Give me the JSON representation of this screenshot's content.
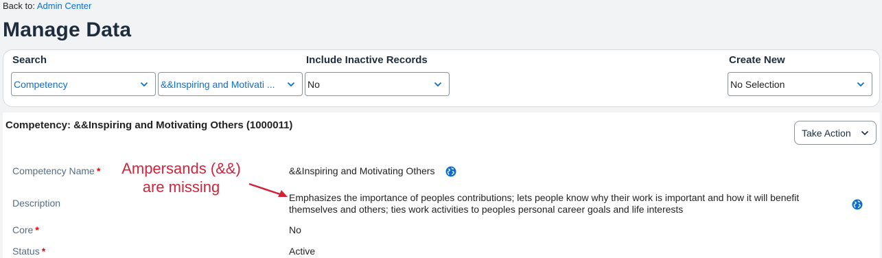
{
  "back": {
    "prefix": "Back to:",
    "link": "Admin Center"
  },
  "page_title": "Manage Data",
  "search": {
    "label": "Search",
    "type_value": "Competency",
    "record_value": "&&Inspiring and Motivati ...",
    "inactive_label": "Include Inactive Records",
    "inactive_value": "No",
    "create_label": "Create New",
    "create_value": "No Selection"
  },
  "record": {
    "title": "Competency: &&Inspiring and Motivating Others (1000011)",
    "take_action": "Take Action",
    "fields": {
      "name_label": "Competency Name",
      "name_value": "&&Inspiring and Motivating Others",
      "description_label": "Description",
      "description_value": "Emphasizes the importance of peoples contributions; lets people know why their work is important and how it will benefit themselves and others; ties work activities to peoples personal career goals and life interests",
      "core_label": "Core",
      "core_value": "No",
      "status_label": "Status",
      "status_value": "Active",
      "required_mark": "*"
    }
  },
  "annotation": {
    "line1": "Ampersands (&&)",
    "line2": "are missing"
  },
  "colors": {
    "link": "#0a6ed1",
    "required": "#e00000",
    "annotation": "#d0243a",
    "label": "#556b82"
  },
  "icons": [
    "chevron-down-icon",
    "globe-icon",
    "arrow-annotation"
  ]
}
